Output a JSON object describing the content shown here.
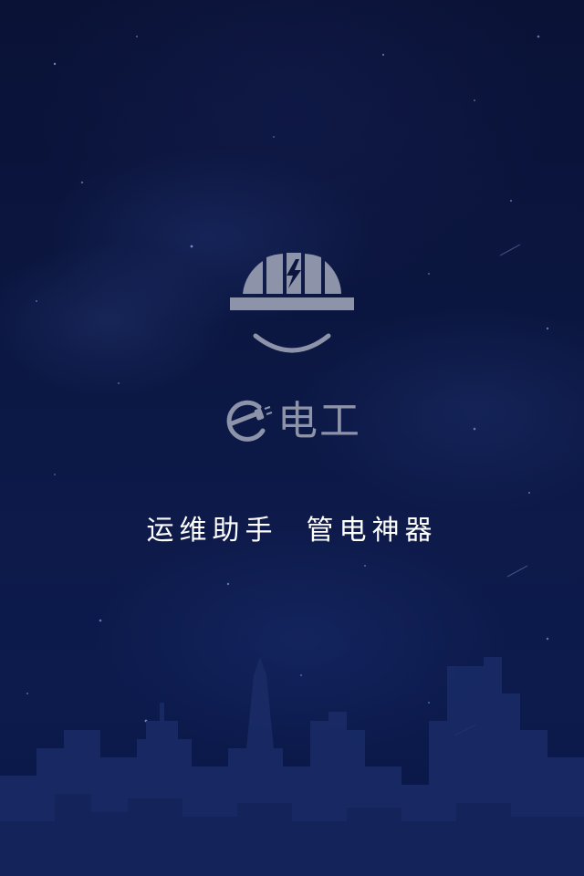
{
  "app": {
    "name": "电工"
  },
  "splash": {
    "slogan": "运维助手  管电神器"
  },
  "icons": {
    "logo": "helmet-smile-icon",
    "brand_mark": "e-plug-icon"
  },
  "colors": {
    "background_top": "#0a1236",
    "background_bottom": "#0c1a4c",
    "logo_gray": "#8d93a8",
    "slogan_text": "#ffffff",
    "skyline": "#1a2c66"
  }
}
